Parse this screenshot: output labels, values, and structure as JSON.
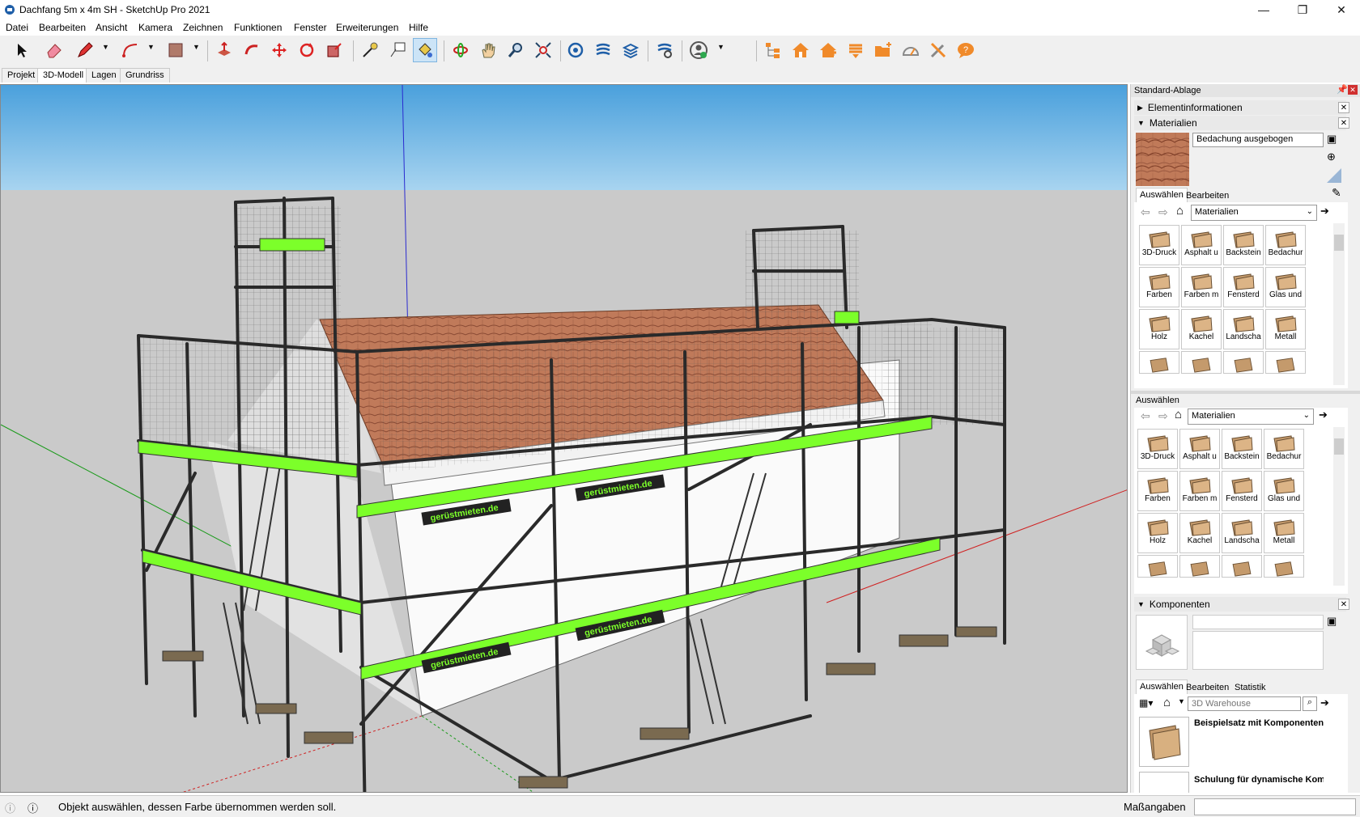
{
  "window": {
    "title": "Dachfang 5m x 4m SH - SketchUp Pro 2021"
  },
  "menu": [
    "Datei",
    "Bearbeiten",
    "Ansicht",
    "Kamera",
    "Zeichnen",
    "Funktionen",
    "Fenster",
    "Erweiterungen",
    "Hilfe"
  ],
  "scene_tabs": [
    {
      "label": "Projekt"
    },
    {
      "label": "3D-Modell",
      "active": true
    },
    {
      "label": "Lagen"
    },
    {
      "label": "Grundriss"
    }
  ],
  "model": {
    "banner_text": "gerüstmieten.de"
  },
  "panel": {
    "title": "Standard-Ablage",
    "entity_info": "Elementinformationen",
    "materials": {
      "header": "Materialien",
      "current_name": "Bedachung ausgebogen",
      "tabs": [
        "Auswählen",
        "Bearbeiten"
      ],
      "library": "Materialien",
      "items": [
        "3D-Druck",
        "Asphalt u",
        "Backstein",
        "Bedachur",
        "Farben",
        "Farben m",
        "Fensterd",
        "Glas und",
        "Holz",
        "Kachel",
        "Landscha",
        "Metall"
      ]
    },
    "secondary": {
      "label": "Auswählen",
      "library": "Materialien",
      "items": [
        "3D-Druck",
        "Asphalt u",
        "Backstein",
        "Bedachur",
        "Farben",
        "Farben m",
        "Fensterd",
        "Glas und",
        "Holz",
        "Kachel",
        "Landscha",
        "Metall"
      ]
    },
    "components": {
      "header": "Komponenten",
      "tabs": [
        "Auswählen",
        "Bearbeiten",
        "Statistik"
      ],
      "search_placeholder": "3D Warehouse",
      "results": [
        "Beispielsatz mit Komponenten",
        "Schulung für dynamische Kom"
      ]
    }
  },
  "status": {
    "message": "Objekt auswählen, dessen Farbe übernommen werden soll.",
    "measure_label": "Maßangaben"
  },
  "colors": {
    "sky": "#5aa8de",
    "ground": "#c8c8c8",
    "roof": "#b8775a",
    "accent": "#7cff2a"
  }
}
